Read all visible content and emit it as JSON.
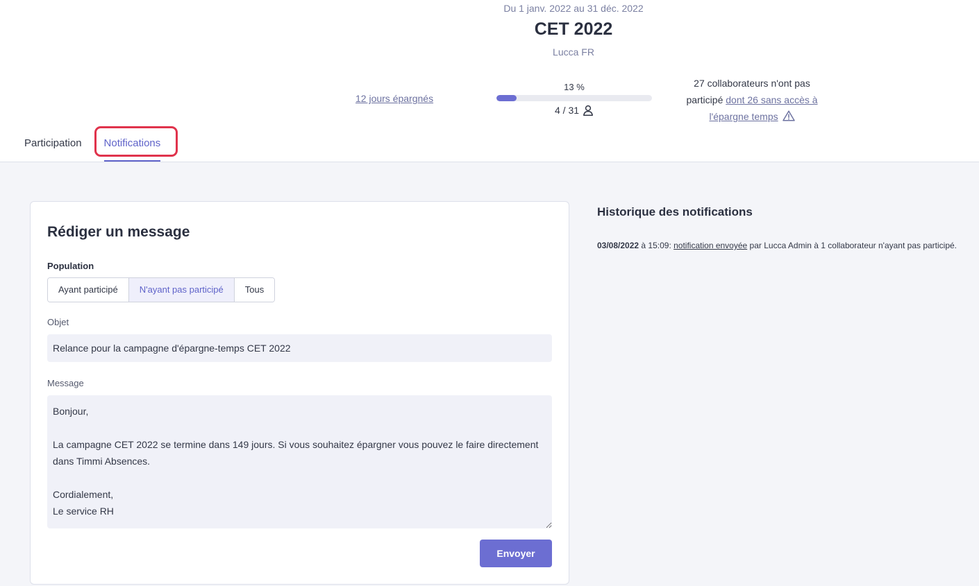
{
  "header": {
    "period": "Du 1 janv. 2022 au 31 déc. 2022",
    "title": "CET 2022",
    "company": "Lucca FR"
  },
  "stats": {
    "saved_days_link": "12 jours épargnés",
    "progress_percent_label": "13 %",
    "progress_fraction": 0.13,
    "participants_count": "4 / 31",
    "nonparticipants_text": "27 collaborateurs n'ont pas participé",
    "nonparticipants_link": "dont 26 sans accès à l'épargne temps"
  },
  "tabs": [
    {
      "label": "Participation"
    },
    {
      "label": "Notifications"
    }
  ],
  "compose": {
    "title": "Rédiger un message",
    "population_label": "Population",
    "population_options": [
      "Ayant participé",
      "N'ayant pas participé",
      "Tous"
    ],
    "population_selected": "N'ayant pas participé",
    "subject_label": "Objet",
    "subject_value": "Relance pour la campagne d'épargne-temps CET 2022",
    "message_label": "Message",
    "message_value": "Bonjour,\n\nLa campagne CET 2022 se termine dans 149 jours. Si vous souhaitez épargner vous pouvez le faire directement dans Timmi Absences.\n\nCordialement,\nLe service RH",
    "send_label": "Envoyer"
  },
  "history": {
    "title": "Historique des notifications",
    "entries": [
      {
        "date": "03/08/2022",
        "time_text": "à 15:09:",
        "link": "notification envoyée",
        "details": "par Lucca Admin à 1 collaborateur n'ayant pas participé."
      }
    ]
  },
  "colors": {
    "accent": "#6c6ed2",
    "highlight": "#e0334c"
  }
}
